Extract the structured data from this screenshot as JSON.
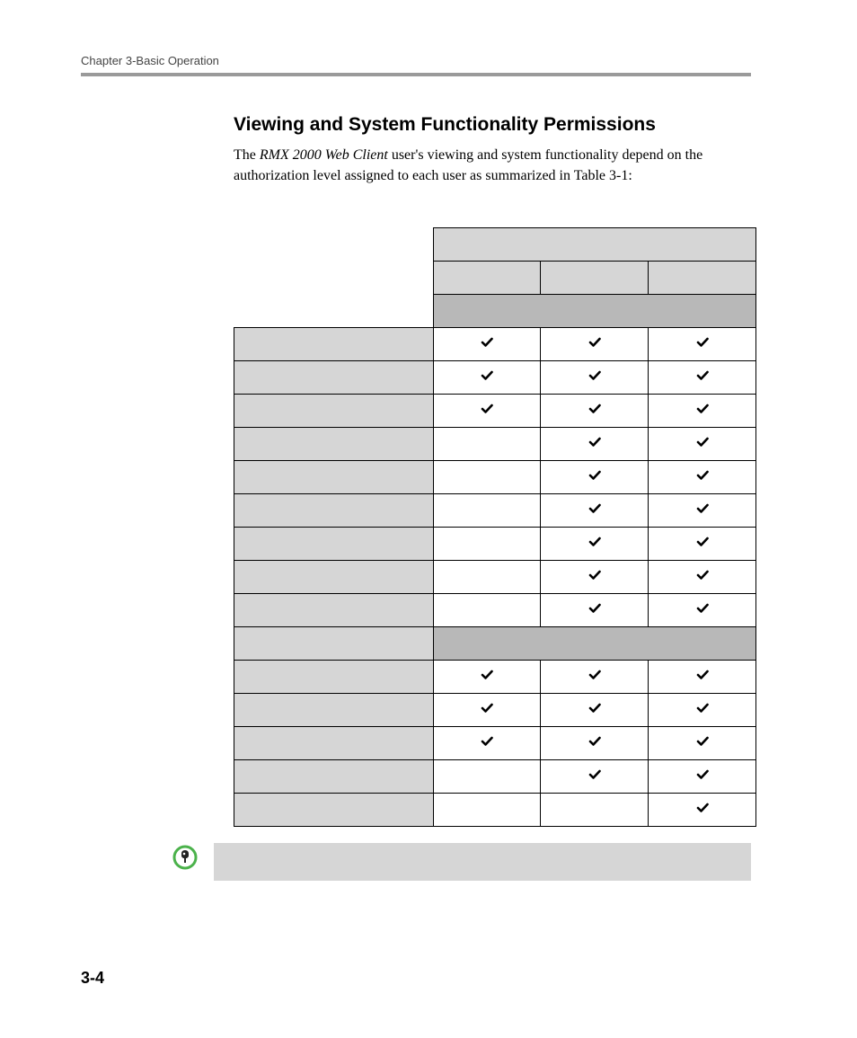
{
  "running_header": "Chapter 3-Basic Operation",
  "section_title": "Viewing and System Functionality Permissions",
  "intro_prefix": "The ",
  "intro_em": "RMX 2000 Web Client",
  "intro_suffix": " user's viewing and system functionality depend on the authorization level assigned to each user as summarized in Table 3-1:",
  "page_number": "3-4",
  "table": {
    "header_top": "",
    "columns": [
      "",
      "",
      ""
    ],
    "header_bar": "",
    "rows": [
      {
        "label": "",
        "cells": [
          true,
          true,
          true
        ]
      },
      {
        "label": "",
        "cells": [
          true,
          true,
          true
        ]
      },
      {
        "label": "",
        "cells": [
          true,
          true,
          true
        ]
      },
      {
        "label": "",
        "cells": [
          false,
          true,
          true
        ]
      },
      {
        "label": "",
        "cells": [
          false,
          true,
          true
        ]
      },
      {
        "label": "",
        "cells": [
          false,
          true,
          true
        ]
      },
      {
        "label": "",
        "cells": [
          false,
          true,
          true
        ]
      },
      {
        "label": "",
        "cells": [
          false,
          true,
          true
        ]
      },
      {
        "label": "",
        "cells": [
          false,
          true,
          true
        ]
      }
    ],
    "category_label": "",
    "rows2": [
      {
        "label": "",
        "cells": [
          true,
          true,
          true
        ]
      },
      {
        "label": "",
        "cells": [
          true,
          true,
          true
        ]
      },
      {
        "label": "",
        "cells": [
          true,
          true,
          true
        ]
      },
      {
        "label": "",
        "cells": [
          false,
          true,
          true
        ]
      },
      {
        "label": "",
        "cells": [
          false,
          false,
          true
        ]
      }
    ]
  },
  "note_text": "",
  "icons": {
    "check": "check-icon",
    "pin": "pin-icon"
  }
}
